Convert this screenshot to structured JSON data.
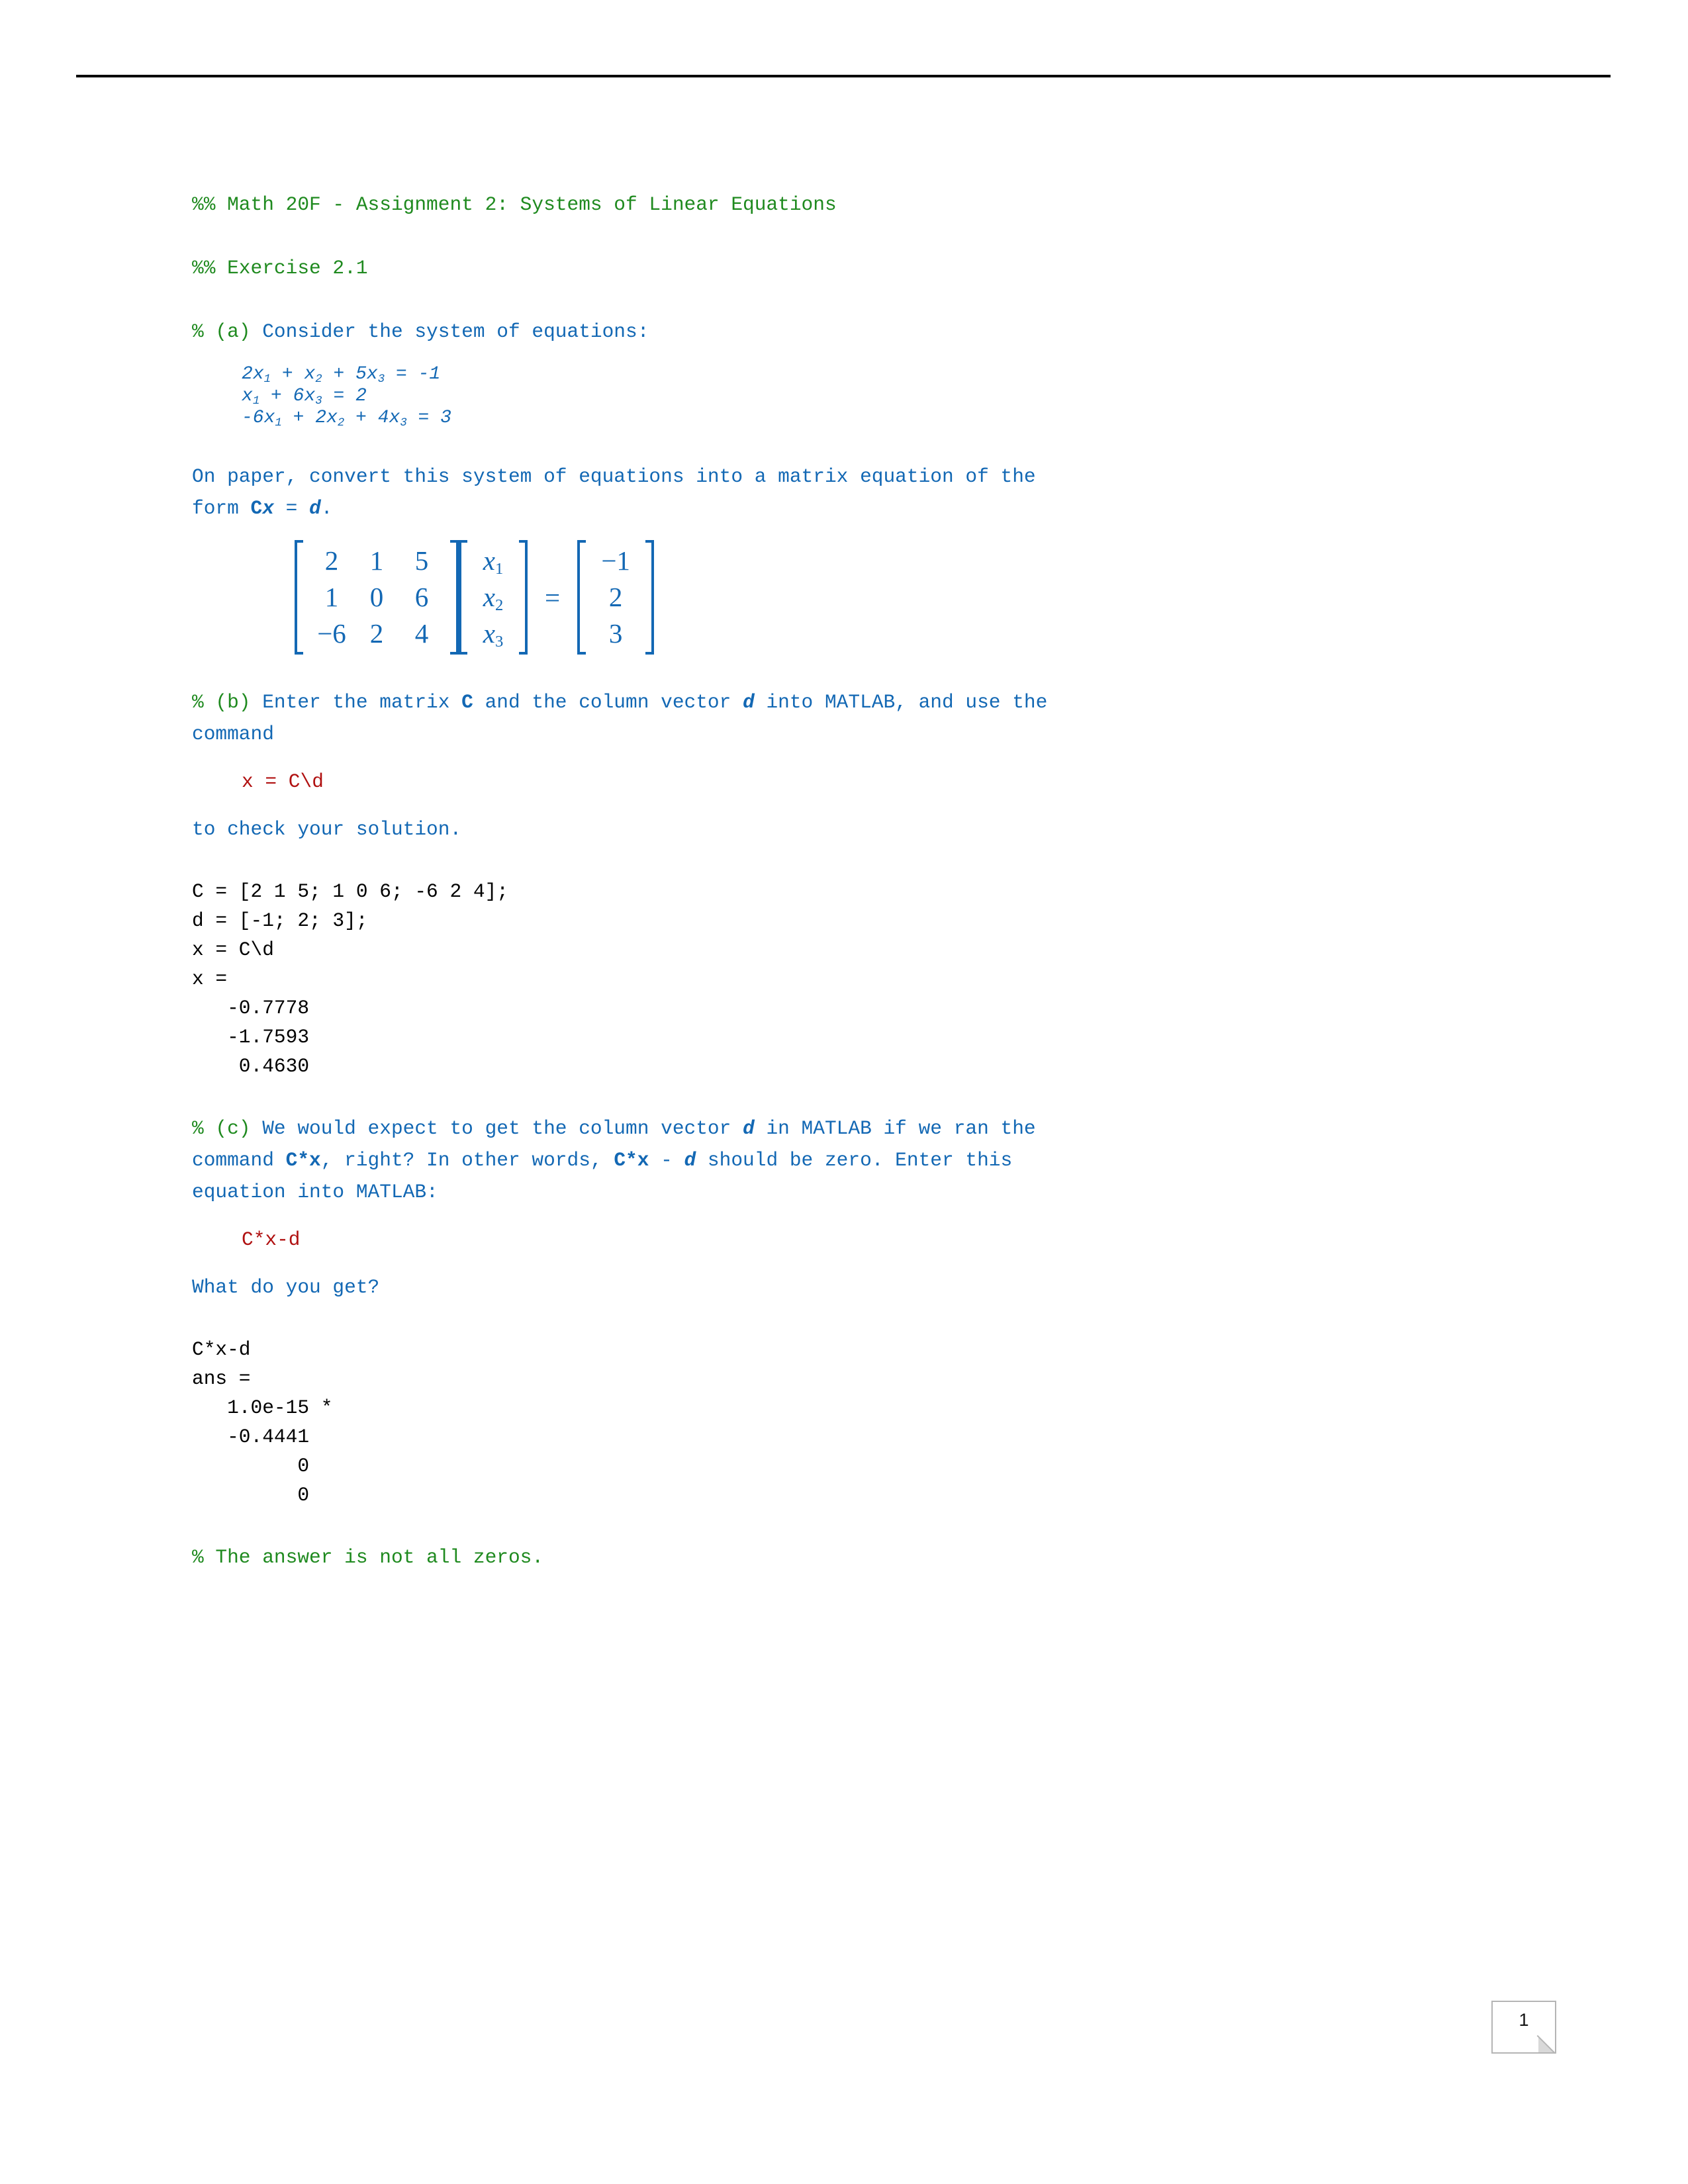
{
  "document": {
    "header_rule": true,
    "page_number": "1"
  },
  "title": {
    "assignment_heading": "%% Math 20F - Assignment 2: Systems of Linear Equations",
    "exercise_heading": "%% Exercise 2.1"
  },
  "part_a": {
    "marker": "% (a)",
    "prompt": "Consider the system of equations:",
    "equations": [
      {
        "terms": "2x1 + x2 + 5x3 = -1"
      },
      {
        "terms": "x1 + 6x3 = 2"
      },
      {
        "terms": "-6x1 + 2x2 + 4x3 = 3"
      }
    ],
    "instruction_line1": "On paper, convert this system of equations into a matrix equation of the",
    "instruction_line2_pre": "form ",
    "instruction_matrix_sym": "C",
    "instruction_vector_sym": "x",
    "instruction_eq": " = ",
    "instruction_rhs_sym": "d",
    "instruction_period": "."
  },
  "matrix_equation": {
    "coefficients": [
      [
        "2",
        "1",
        "5"
      ],
      [
        "1",
        "0",
        "6"
      ],
      [
        "−6",
        "2",
        "4"
      ]
    ],
    "unknowns": [
      {
        "base": "x",
        "sub": "1"
      },
      {
        "base": "x",
        "sub": "2"
      },
      {
        "base": "x",
        "sub": "3"
      }
    ],
    "equals": "=",
    "rhs": [
      "−1",
      "2",
      "3"
    ]
  },
  "part_b": {
    "marker": "% (b)",
    "text_pre": "Enter the matrix ",
    "sym_C": "C",
    "text_mid": " and the column vector ",
    "sym_d": "d",
    "text_post": " into MATLAB, and use the",
    "text_line2": "command",
    "command": "x = C\\d",
    "closing": "to check your solution."
  },
  "output_b": {
    "lines": [
      "C = [2 1 5; 1 0 6; -6 2 4];",
      "d = [-1; 2; 3];",
      "x = C\\d",
      "x =",
      "   -0.7778",
      "   -1.7593",
      "    0.4630"
    ]
  },
  "part_c": {
    "marker": "% (c)",
    "text1": "We would expect to get the column vector ",
    "sym_d1": "d",
    "text2": " in MATLAB if we ran the",
    "text3": "command ",
    "sym_Cx1": "C*x",
    "text4": ", right? In other words, ",
    "sym_Cx2": "C*x",
    "text5": " - ",
    "sym_d2": "d",
    "text6": " should be zero. Enter this",
    "text7": "equation into MATLAB:",
    "command": "C*x-d",
    "question": "What do you get?"
  },
  "output_c": {
    "lines": [
      "C*x-d",
      "ans =",
      "   1.0e-15 *",
      "   -0.4441",
      "         0",
      "         0"
    ]
  },
  "conclusion": {
    "text": "% The answer is not all zeros."
  },
  "colors": {
    "comment_green": "#1f8a1f",
    "body_blue": "#1368b4",
    "command_red": "#b01010",
    "output_black": "#000000",
    "rule_black": "#000000",
    "badge_border": "#b5b5b5"
  }
}
